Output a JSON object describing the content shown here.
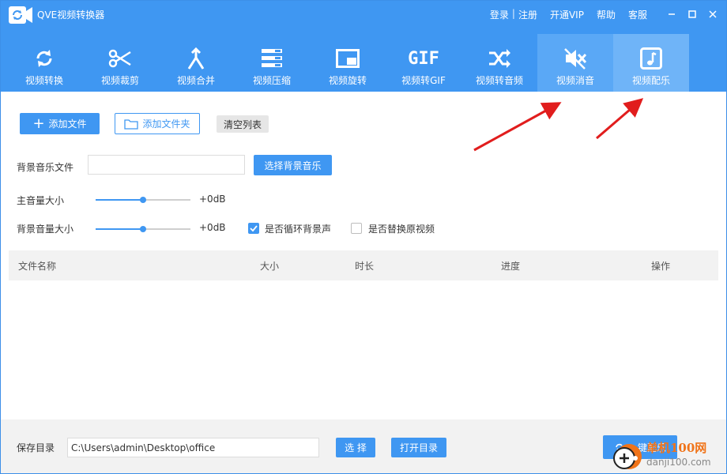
{
  "app": {
    "title": "QVE视频转换器"
  },
  "top_links": {
    "login": "登录",
    "sep": "|",
    "register": "注册",
    "vip": "开通VIP",
    "help": "帮助",
    "service": "客服"
  },
  "toolbar": {
    "items": [
      {
        "label": "视频转换",
        "icon": "refresh-icon"
      },
      {
        "label": "视频裁剪",
        "icon": "scissors-icon"
      },
      {
        "label": "视频合并",
        "icon": "merge-icon"
      },
      {
        "label": "视频压缩",
        "icon": "compress-icon"
      },
      {
        "label": "视频旋转",
        "icon": "rotate-icon"
      },
      {
        "label": "视频转GIF",
        "icon": "gif-icon"
      },
      {
        "label": "视频转音频",
        "icon": "shuffle-icon"
      },
      {
        "label": "视频消音",
        "icon": "mute-icon"
      },
      {
        "label": "视频配乐",
        "icon": "music-note-icon"
      }
    ],
    "gif_text": "GIF"
  },
  "actions": {
    "add_file": "添加文件",
    "add_folder": "添加文件夹",
    "clear_list": "清空列表"
  },
  "bg_music": {
    "label": "背景音乐文件",
    "value": "",
    "button": "选择背景音乐"
  },
  "main_volume": {
    "label": "主音量大小",
    "value": "+0dB",
    "level": 0.5
  },
  "bg_volume": {
    "label": "背景音量大小",
    "value": "+0dB",
    "level": 0.5
  },
  "options": {
    "loop_bg": "是否循环背景声",
    "loop_bg_checked": true,
    "replace_video": "是否替换原视频",
    "replace_video_checked": false
  },
  "table": {
    "columns": [
      "文件名称",
      "大小",
      "时长",
      "进度",
      "操作"
    ]
  },
  "footer": {
    "save_label": "保存目录",
    "save_path": "C:\\Users\\admin\\Desktop\\office",
    "choose": "选 择",
    "open_dir": "打开目录",
    "one_click": "一键配乐"
  },
  "watermark": {
    "line1": "单机100网",
    "line2": "danji100.com"
  },
  "colors": {
    "accent": "#3f97f2",
    "arrow": "#e11d1d",
    "watermark": "#f0741a"
  }
}
